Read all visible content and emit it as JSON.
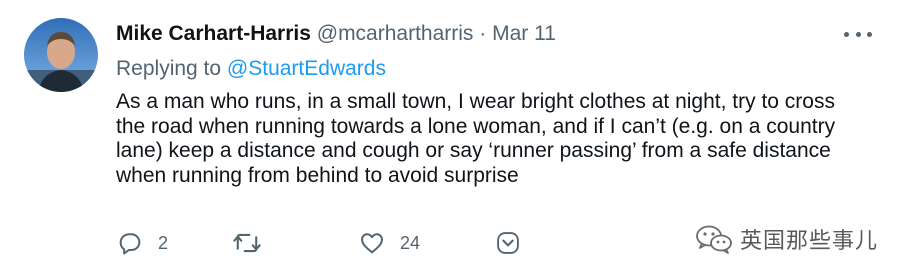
{
  "tweet": {
    "author_name": "Mike Carhart-Harris",
    "author_handle": "@mcarhartharris",
    "separator": "·",
    "date": "Mar 11",
    "replying_prefix": "Replying to",
    "replying_to": "@StuartEdwards",
    "body": "As a man who runs, in a small town, I wear bright clothes at night, try to cross the road when running towards a lone woman, and if I can’t (e.g. on a country lane) keep a distance and cough or say ‘runner passing’ from a safe distance when running from behind to avoid surprise"
  },
  "actions": {
    "reply_count": "2",
    "retweet_count": "",
    "like_count": "24"
  },
  "watermark": {
    "text": "英国那些事儿"
  },
  "icons": [
    "more-icon",
    "reply-icon",
    "retweet-icon",
    "like-icon",
    "share-icon",
    "wechat-icon"
  ],
  "colors": {
    "text": "#0f1419",
    "secondary": "#536471",
    "link": "#1d9bf0",
    "background": "#ffffff"
  }
}
